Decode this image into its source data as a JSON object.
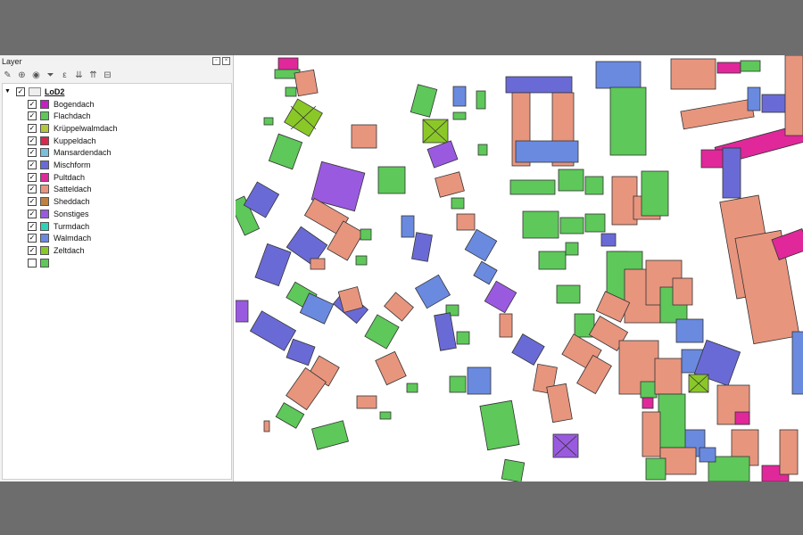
{
  "panel": {
    "title": "Layer"
  },
  "tree": {
    "group_label": "LoD2",
    "items": [
      {
        "label": "Bogendach",
        "color": "#c81ec8"
      },
      {
        "label": "Flachdach",
        "color": "#5ec85a"
      },
      {
        "label": "Krüppelwalmdach",
        "color": "#b4c83a"
      },
      {
        "label": "Kuppeldach",
        "color": "#d8284c"
      },
      {
        "label": "Mansardendach",
        "color": "#78c0dc"
      },
      {
        "label": "Mischform",
        "color": "#6a6ad6"
      },
      {
        "label": "Pultdach",
        "color": "#e0289a"
      },
      {
        "label": "Satteldach",
        "color": "#e8957e"
      },
      {
        "label": "Sheddach",
        "color": "#c08040"
      },
      {
        "label": "Sonstiges",
        "color": "#9a5ae0"
      },
      {
        "label": "Turmdach",
        "color": "#2ed4b8"
      },
      {
        "label": "Walmdach",
        "color": "#6a8ae0"
      },
      {
        "label": "Zeltdach",
        "color": "#8ac828"
      },
      {
        "label": "",
        "color": "#5ec85a"
      }
    ]
  },
  "colors": {
    "flach": "#5ec85a",
    "sattel": "#e8957e",
    "walm": "#6a8ae0",
    "misch": "#6a6ad6",
    "sonst": "#9a5ae0",
    "pult": "#e0289a",
    "zelt": "#8ac828"
  }
}
